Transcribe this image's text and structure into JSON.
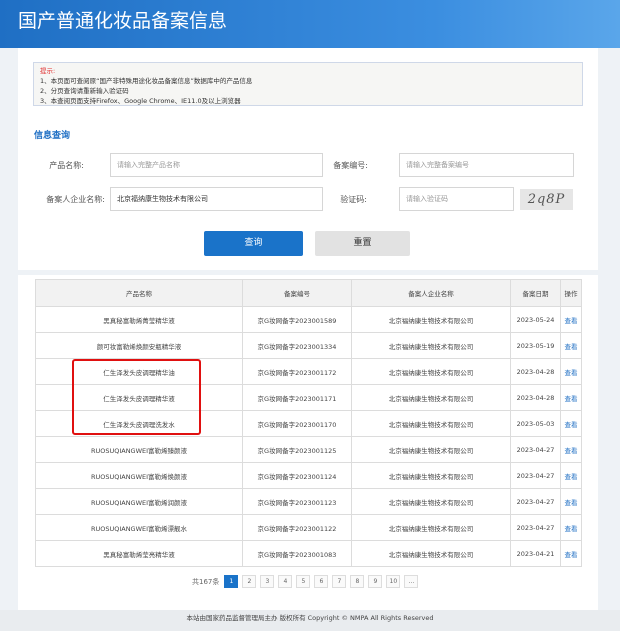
{
  "header": {
    "title": "国产普通化妆品备案信息"
  },
  "notice": {
    "title": "提示:",
    "lines": [
      "1、本页面可查阅原“国产非特殊用途化妆品备案信息”数据库中的产品信息",
      "2、分页查询请重新输入验证码",
      "3、本查阅页面支持Firefox、Google Chrome、IE11.0及以上浏览器"
    ]
  },
  "search": {
    "section_title": "信息查询",
    "product_label": "产品名称:",
    "product_placeholder": "请输入完整产品名称",
    "record_label": "备案编号:",
    "record_placeholder": "请输入完整备案编号",
    "company_label": "备案人企业名称:",
    "company_value": "北京福纳康生物技术有限公司",
    "captcha_label": "验证码:",
    "captcha_placeholder": "请输入验证码",
    "captcha_text": "2q8P",
    "search_button": "查询",
    "reset_button": "重置"
  },
  "table": {
    "headers": [
      "产品名称",
      "备案编号",
      "备案人企业名称",
      "备案日期",
      "操作"
    ],
    "rows": [
      [
        "黑真秘富勒烯菁莹精华液",
        "京G妆网备字2023001589",
        "北京福纳康生物技术有限公司",
        "2023-05-24",
        "查看"
      ],
      [
        "颜可妆富勒烯焕颜安瓶精华液",
        "京G妆网备字2023001334",
        "北京福纳康生物技术有限公司",
        "2023-05-19",
        "查看"
      ],
      [
        "仁生泽发头皮调理精华油",
        "京G妆网备字2023001172",
        "北京福纳康生物技术有限公司",
        "2023-04-28",
        "查看"
      ],
      [
        "仁生泽发头皮调理精华液",
        "京G妆网备字2023001171",
        "北京福纳康生物技术有限公司",
        "2023-04-28",
        "查看"
      ],
      [
        "仁生泽发头皮调理洗发水",
        "京G妆网备字2023001170",
        "北京福纳康生物技术有限公司",
        "2023-05-03",
        "查看"
      ],
      [
        "RUOSUQIANGWEI富勒烯臻颜液",
        "京G妆网备字2023001125",
        "北京福纳康生物技术有限公司",
        "2023-04-27",
        "查看"
      ],
      [
        "RUOSUQIANGWEI富勒烯焕颜液",
        "京G妆网备字2023001124",
        "北京福纳康生物技术有限公司",
        "2023-04-27",
        "查看"
      ],
      [
        "RUOSUQIANGWEI富勒烯润颜液",
        "京G妆网备字2023001123",
        "北京福纳康生物技术有限公司",
        "2023-04-27",
        "查看"
      ],
      [
        "RUOSUQIANGWEI富勒烯漂靓水",
        "京G妆网备字2023001122",
        "北京福纳康生物技术有限公司",
        "2023-04-27",
        "查看"
      ],
      [
        "黑真秘富勒烯莹亮精华液",
        "京G妆网备字2023001083",
        "北京福纳康生物技术有限公司",
        "2023-04-21",
        "查看"
      ]
    ]
  },
  "pagination": {
    "total": "共167条",
    "pages": [
      "1",
      "2",
      "3",
      "4",
      "5",
      "6",
      "7",
      "8",
      "9",
      "10",
      "..."
    ],
    "current": "1"
  },
  "footer": {
    "text": "本站由国家药品监督管理局主办 版权所有 Copyright © NMPA All Rights Reserved"
  }
}
